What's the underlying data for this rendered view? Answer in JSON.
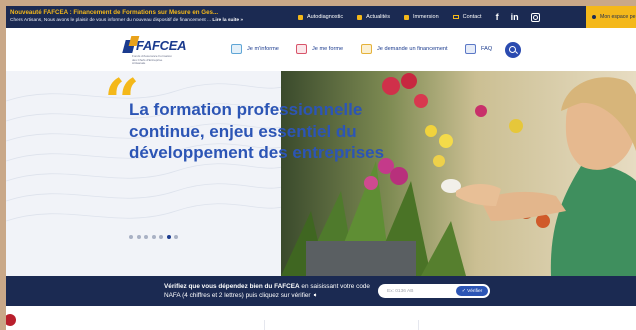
{
  "topbar": {
    "news_title": "Nouveauté FAFCEA : Financement de Formations sur Mesure en Ges...",
    "news_text": "Chers Artisans, Nous avons le plaisir de vous informer du nouveau dispositif de financement ...",
    "news_more": "Lire la suite »",
    "links": [
      "Autodiagnostic",
      "Actualités",
      "Immersion",
      "Contact"
    ],
    "account_label": "Mon espace pe"
  },
  "nav": {
    "logo_word": "FAFCEA",
    "logo_tagline": "Fonds d'Assurance Formation des Chefs d'Entreprise Artisanale",
    "items": [
      "Je m'informe",
      "Je me forme",
      "Je demande un financement",
      "FAQ"
    ]
  },
  "hero": {
    "quote_mark": "“",
    "headline": "La formation professionnelle continue, enjeu essentiel du développement des entreprises",
    "slides_total": 7,
    "slides_active": 6
  },
  "check": {
    "text_bold": "Vérifiez que vous dépendez bien du FAFCEA",
    "text_rest": " en saisissant votre code NAFA (4 chiffres et 2 lettres) puis cliquez sur vérifier ➧",
    "placeholder": "Ex: 0136 AB",
    "button": "✓ Vérifier"
  },
  "colors": {
    "navy": "#1b2a52",
    "accent_yellow": "#f4b81a",
    "brand_blue": "#2c55b5"
  },
  "icons": {
    "social": [
      "facebook-icon",
      "linkedin-icon",
      "instagram-icon"
    ]
  }
}
